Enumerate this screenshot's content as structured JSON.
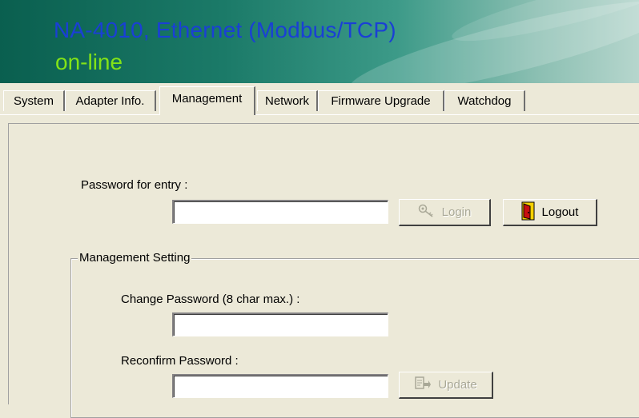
{
  "header": {
    "title": "NA-4010, Ethernet (Modbus/TCP)",
    "status": "on-line",
    "colors": {
      "title": "#1a3fd6",
      "status": "#83e317",
      "banner": "#0a5f4f"
    }
  },
  "tabs": [
    {
      "label": "System"
    },
    {
      "label": "Adapter Info."
    },
    {
      "label": "Management",
      "active": true
    },
    {
      "label": "Network"
    },
    {
      "label": "Firmware Upgrade"
    },
    {
      "label": "Watchdog"
    }
  ],
  "login": {
    "password_label": "Password for entry :",
    "password_value": "",
    "login_label": "Login",
    "login_icon": "key-icon",
    "logout_label": "Logout",
    "logout_icon": "door-exit-icon"
  },
  "management": {
    "group_title": "Management Setting",
    "change_label": "Change Password (8 char max.) :",
    "change_value": "",
    "reconfirm_label": "Reconfirm Password :",
    "reconfirm_value": "",
    "update_label": "Update",
    "update_icon": "document-update-icon"
  }
}
